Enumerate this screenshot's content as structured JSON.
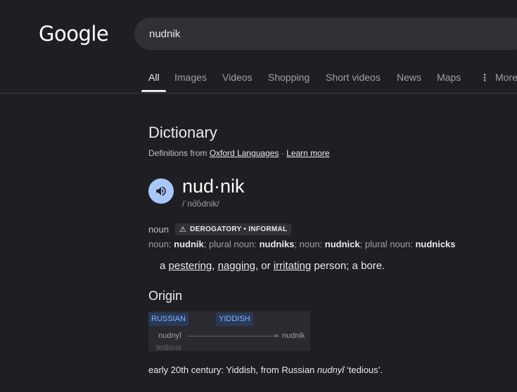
{
  "header": {
    "logo_text": "Google",
    "search_value": "nudnik"
  },
  "tabs": [
    {
      "label": "All",
      "active": true
    },
    {
      "label": "Images"
    },
    {
      "label": "Videos"
    },
    {
      "label": "Shopping"
    },
    {
      "label": "Short videos"
    },
    {
      "label": "News"
    },
    {
      "label": "Maps"
    },
    {
      "label": "More",
      "icon": "more-vert-icon"
    }
  ],
  "dictionary": {
    "title": "Dictionary",
    "source_prefix": "Definitions from",
    "source_link": "Oxford Languages",
    "separator": "·",
    "learn_more": "Learn more",
    "speaker_icon": "speaker-icon",
    "word": "nud·nik",
    "pronunciation": "/ˈno͝odnik/",
    "part_of_speech": "noun",
    "usage_labels": "DEROGATORY • INFORMAL",
    "forms": [
      {
        "label": "noun",
        "value": "nudnik"
      },
      {
        "label": "plural noun",
        "value": "nudniks"
      },
      {
        "label": "noun",
        "value": "nudnick"
      },
      {
        "label": "plural noun",
        "value": "nudnicks"
      }
    ],
    "definition": {
      "prefix": "a",
      "link1": "pestering",
      "sep1": ",",
      "link2": "nagging",
      "sep2": ", or",
      "link3": "irritating",
      "suffix": "person; a bore."
    }
  },
  "origin": {
    "title": "Origin",
    "lang1": "RUSSIAN",
    "lang2": "YIDDISH",
    "source_word": "nudnyĭ",
    "source_gloss": "tedious",
    "target_word": "nudnik",
    "etymology_prefix": "early 20th century: Yiddish, from Russian",
    "etymology_word": "nudnyĭ",
    "etymology_suffix": "‘tedious’."
  },
  "colors": {
    "background": "#1f1f23",
    "speaker_button": "#a8c7fa",
    "language_tag": "#8ab4f8"
  }
}
